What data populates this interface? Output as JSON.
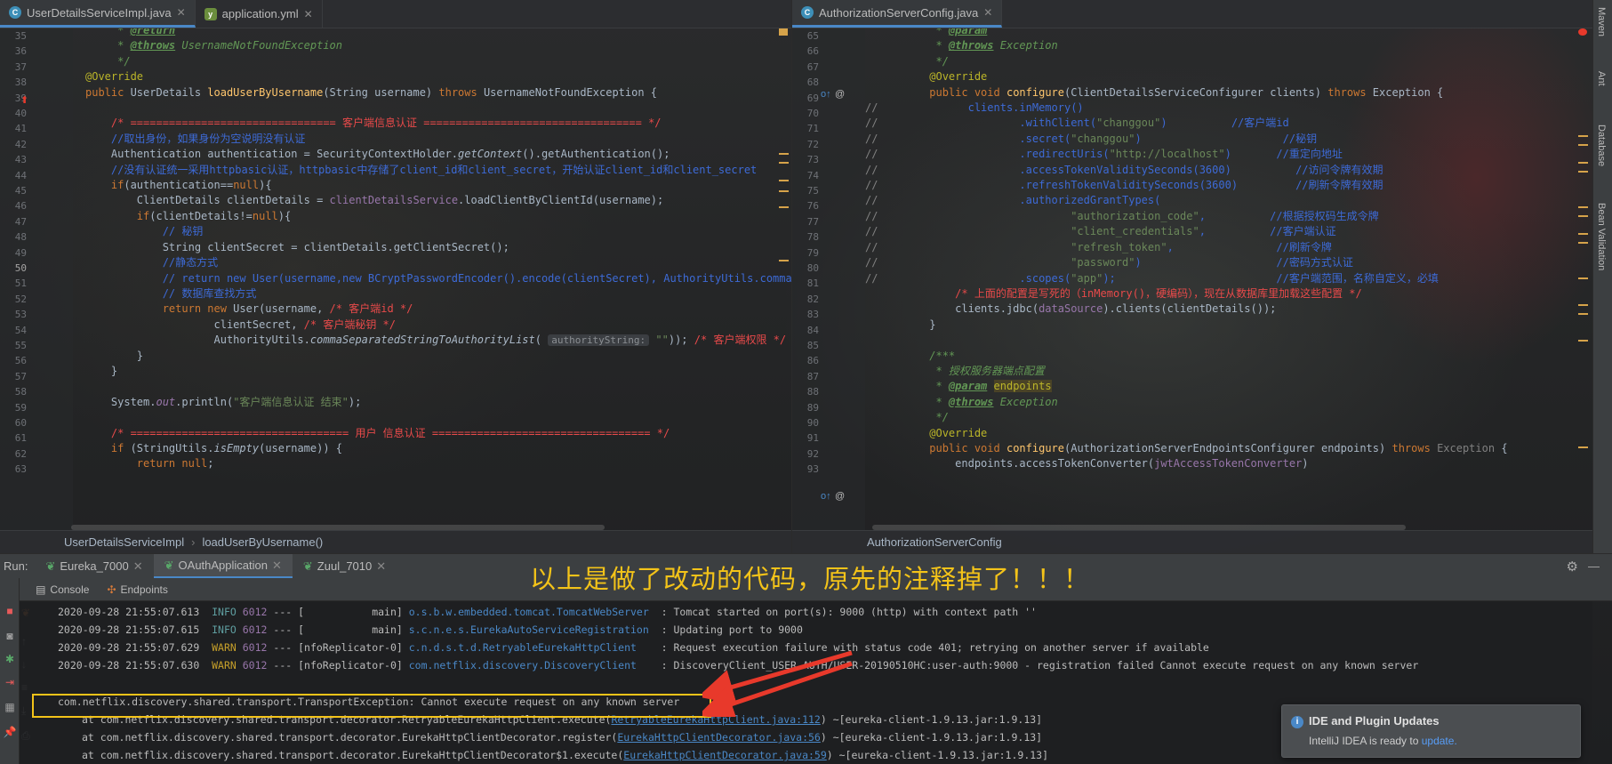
{
  "left_tabs": [
    {
      "label": "UserDetailsServiceImpl.java",
      "icon": "java-class-icon",
      "active": true
    },
    {
      "label": "application.yml",
      "icon": "yml-file-icon",
      "active": false
    }
  ],
  "right_tabs": [
    {
      "label": "AuthorizationServerConfig.java",
      "icon": "java-class-icon",
      "active": true
    }
  ],
  "left_editor": {
    "line_numbers": [
      "35",
      "36",
      "37",
      "38",
      "39",
      "40",
      "41",
      "42",
      "43",
      "44",
      "45",
      "46",
      "47",
      "48",
      "49",
      "50",
      "51",
      "52",
      "53",
      "54",
      "55",
      "56",
      "57",
      "58",
      "59",
      "60",
      "61",
      "62",
      "63"
    ],
    "breadcrumb": [
      "UserDetailsServiceImpl",
      "loadUserByUsername()"
    ]
  },
  "right_editor": {
    "line_numbers": [
      "65",
      "66",
      "67",
      "68",
      "69",
      "70",
      "71",
      "72",
      "73",
      "74",
      "75",
      "76",
      "77",
      "78",
      "79",
      "80",
      "81",
      "82",
      "83",
      "84",
      "85",
      "86",
      "87",
      "88",
      "89",
      "90",
      "91",
      "92",
      "93"
    ],
    "breadcrumb": [
      "AuthorizationServerConfig"
    ]
  },
  "right_tool_windows": [
    "Maven",
    "Ant",
    "Database",
    "Bean Validation"
  ],
  "run_bar": {
    "label": "Run:",
    "tabs": [
      {
        "label": "Eureka_7000",
        "active": false
      },
      {
        "label": "OAuthApplication",
        "active": true
      },
      {
        "label": "Zuul_7010",
        "active": false
      }
    ]
  },
  "console_tabs": [
    "Console",
    "Endpoints"
  ],
  "overlay_caption": "以上是做了改动的代码，原先的注释掉了！！！",
  "console_lines": [
    {
      "ts": "2020-09-28 21:55:07.613",
      "level": "INFO",
      "pid": "6012",
      "sep": "---",
      "thread": "[           main]",
      "logger": "o.s.b.w.embedded.tomcat.TomcatWebServer",
      "msg": ": Tomcat started on port(s): 9000 (http) with context path ''"
    },
    {
      "ts": "2020-09-28 21:55:07.615",
      "level": "INFO",
      "pid": "6012",
      "sep": "---",
      "thread": "[           main]",
      "logger": "s.c.n.e.s.EurekaAutoServiceRegistration",
      "msg": ": Updating port to 9000"
    },
    {
      "ts": "2020-09-28 21:55:07.629",
      "level": "WARN",
      "pid": "6012",
      "sep": "---",
      "thread": "[nfoReplicator-0]",
      "logger": "c.n.d.s.t.d.RetryableEurekaHttpClient",
      "msg": ": Request execution failure with status code 401; retrying on another server if available"
    },
    {
      "ts": "2020-09-28 21:55:07.630",
      "level": "WARN",
      "pid": "6012",
      "sep": "---",
      "thread": "[nfoReplicator-0]",
      "logger": "com.netflix.discovery.DiscoveryClient",
      "msg": ": DiscoveryClient_USER-AUTH/USER-20190510HC:user-auth:9000 - registration failed Cannot execute request on any known server"
    }
  ],
  "exception_line": "com.netflix.discovery.shared.transport.TransportException: Cannot execute request on any known server",
  "stack_lines": [
    {
      "prefix": "at com.netflix.discovery.shared.transport.decorator.RetryableEurekaHttpClient.execute(",
      "link": "RetryableEurekaHttpClient.java:112",
      "suffix": ") ~[eureka-client-1.9.13.jar:1.9.13]"
    },
    {
      "prefix": "at com.netflix.discovery.shared.transport.decorator.EurekaHttpClientDecorator.register(",
      "link": "EurekaHttpClientDecorator.java:56",
      "suffix": ") ~[eureka-client-1.9.13.jar:1.9.13]"
    },
    {
      "prefix": "at com.netflix.discovery.shared.transport.decorator.EurekaHttpClientDecorator$1.execute(",
      "link": "EurekaHttpClientDecorator.java:59",
      "suffix": ") ~[eureka-client-1.9.13.jar:1.9.13]"
    }
  ],
  "notification": {
    "title": "IDE and Plugin Updates",
    "body": "IntelliJ IDEA is ready to",
    "link": "update."
  },
  "colors": {
    "accent": "#4a88c7",
    "highlight_box": "#f3c319",
    "arrow": "#e8392b",
    "caption": "#f3c319"
  }
}
